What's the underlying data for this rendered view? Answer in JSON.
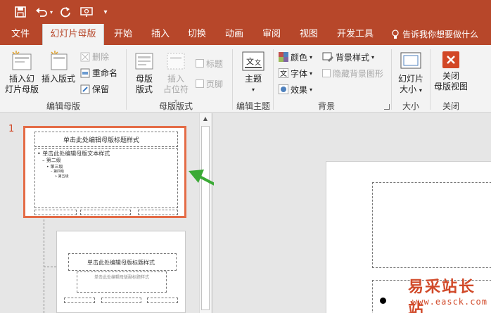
{
  "quick_access": {
    "save": "save-icon",
    "undo": "undo-icon",
    "redo": "redo-icon",
    "present": "present-icon",
    "more": "▾"
  },
  "menu": {
    "tabs": [
      "文件",
      "幻灯片母版",
      "开始",
      "插入",
      "切换",
      "动画",
      "审阅",
      "视图",
      "开发工具"
    ],
    "active_index": 1,
    "tell_me": "告诉我你想要做什么"
  },
  "ribbon": {
    "edit_master": {
      "insert_slide_master": "插入幻\n灯片母版",
      "insert_layout": "插入版式",
      "delete": "删除",
      "rename": "重命名",
      "preserve": "保留",
      "label": "编辑母版"
    },
    "master_layout": {
      "master_layout_btn": "母版\n版式",
      "insert_placeholder": "插入\n占位符",
      "title": "标题",
      "footer": "页脚",
      "label": "母版版式"
    },
    "edit_theme": {
      "themes": "主题",
      "label": "编辑主题"
    },
    "background": {
      "colors": "颜色",
      "fonts": "字体",
      "effects": "效果",
      "bg_styles": "背景样式",
      "hide_bg": "隐藏背景图形",
      "label": "背景"
    },
    "size": {
      "slide_size": "幻灯片\n大小",
      "label": "大小"
    },
    "close": {
      "close_master": "关闭\n母版视图",
      "label": "关闭"
    }
  },
  "thumbnails": {
    "number": "1",
    "master_title": "单击此处编辑母版标题样式",
    "master_text": "• 单击此处编辑母版文本样式",
    "level2": "– 第二级",
    "level3": "• 第三级",
    "level4": "– 第四级",
    "level5": "» 第五级",
    "layout_title": "单击此处编辑母版标题样式",
    "layout_subtitle": "单击此处编辑母版副标题样式"
  },
  "watermark": {
    "text": "易采站长站",
    "url": "www.easck.com"
  },
  "colors": {
    "accent": "#b7472a",
    "highlight": "#e46c47",
    "arrow": "#3aaa35"
  }
}
